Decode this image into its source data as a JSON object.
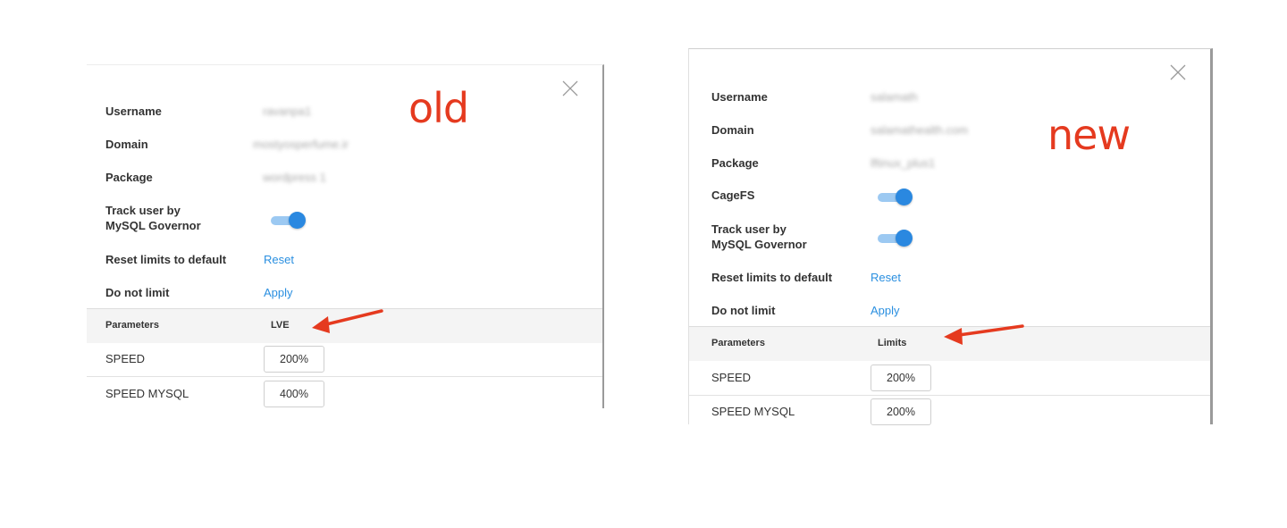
{
  "old": {
    "annotation": "old",
    "fields": {
      "username_label": "Username",
      "username_value": "ravanpa1",
      "domain_label": "Domain",
      "domain_value": "mostyosperfume.ir",
      "package_label": "Package",
      "package_value": "wordpress 1",
      "track_label_line1": "Track user by",
      "track_label_line2": "MySQL Governor",
      "reset_label": "Reset limits to default",
      "reset_link": "Reset",
      "nolimit_label": "Do not limit",
      "nolimit_link": "Apply"
    },
    "toggles": {
      "track_mysql_governor": true
    },
    "table": {
      "col_params": "Parameters",
      "col_values": "LVE",
      "rows": [
        {
          "name": "SPEED",
          "value": "200%"
        },
        {
          "name": "SPEED MYSQL",
          "value": "400%"
        }
      ]
    }
  },
  "new": {
    "annotation": "new",
    "fields": {
      "username_label": "Username",
      "username_value": "salamath",
      "domain_label": "Domain",
      "domain_value": "salamathealth.com",
      "package_label": "Package",
      "package_value": "lftinux_plus1",
      "cagefs_label": "CageFS",
      "track_label_line1": "Track user by",
      "track_label_line2": "MySQL Governor",
      "reset_label": "Reset limits to default",
      "reset_link": "Reset",
      "nolimit_label": "Do not limit",
      "nolimit_link": "Apply"
    },
    "toggles": {
      "cagefs": true,
      "track_mysql_governor": true
    },
    "table": {
      "col_params": "Parameters",
      "col_values": "Limits",
      "rows": [
        {
          "name": "SPEED",
          "value": "200%"
        },
        {
          "name": "SPEED MYSQL",
          "value": "200%"
        }
      ]
    }
  },
  "colors": {
    "accent": "#2a88e0",
    "annotation": "#e53a1f",
    "link": "#2a8fe0"
  },
  "icons": [
    "close-icon",
    "arrow-annotation"
  ]
}
